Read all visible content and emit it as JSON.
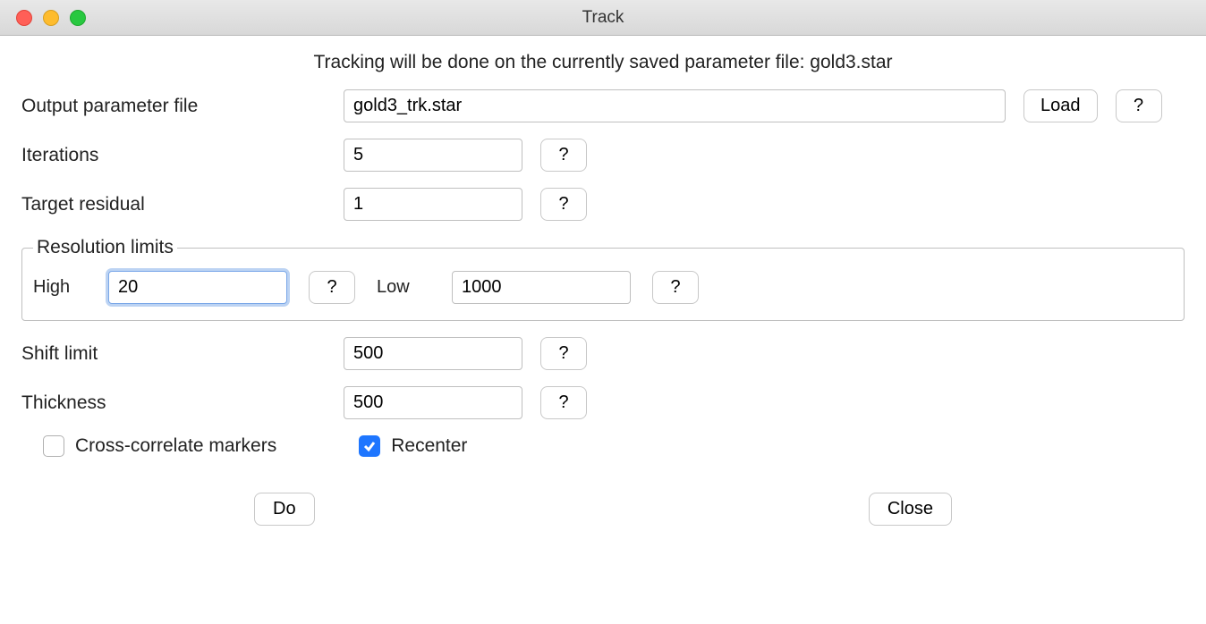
{
  "window": {
    "title": "Track"
  },
  "notice": "Tracking will be done on the currently saved parameter file: gold3.star",
  "fields": {
    "output_param": {
      "label": "Output parameter file",
      "value": "gold3_trk.star"
    },
    "load_button": "Load",
    "iterations": {
      "label": "Iterations",
      "value": "5"
    },
    "target_residual": {
      "label": "Target residual",
      "value": "1"
    },
    "shift_limit": {
      "label": "Shift limit",
      "value": "500"
    },
    "thickness": {
      "label": "Thickness",
      "value": "500"
    }
  },
  "resolution_limits": {
    "legend": "Resolution limits",
    "high_label": "High",
    "high_value": "20",
    "low_label": "Low",
    "low_value": "1000"
  },
  "checkboxes": {
    "cross_correlate": {
      "label": "Cross-correlate markers",
      "checked": false
    },
    "recenter": {
      "label": "Recenter",
      "checked": true
    }
  },
  "buttons": {
    "do": "Do",
    "close": "Close",
    "help": "?"
  }
}
